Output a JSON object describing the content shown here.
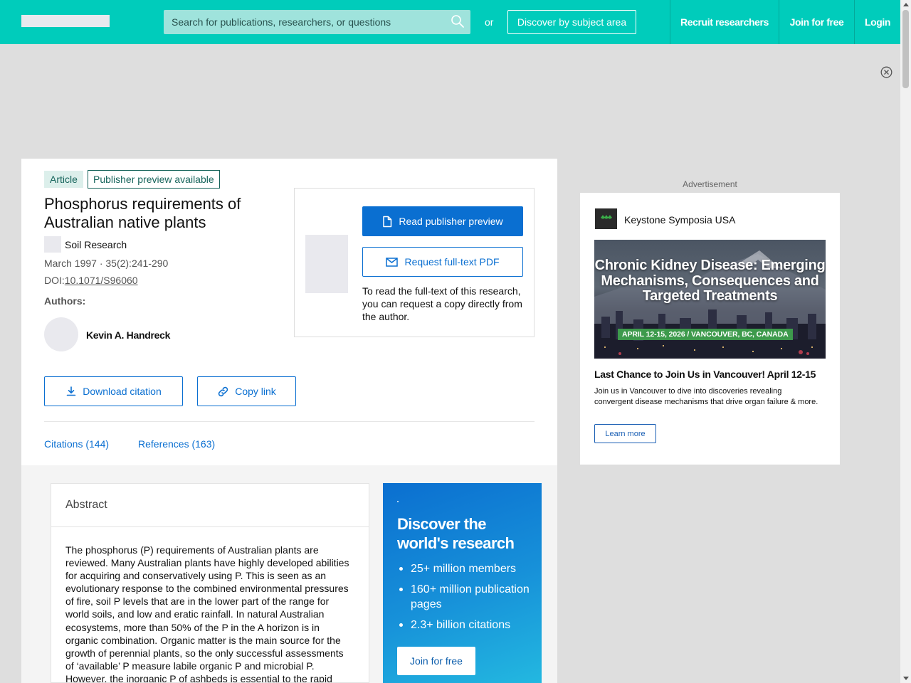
{
  "header": {
    "search_placeholder": "Search for publications, researchers, or questions",
    "or_text": "or",
    "discover_subject": "Discover by subject area",
    "nav": {
      "recruit": "Recruit researchers",
      "join": "Join for free",
      "login": "Login"
    },
    "colors": {
      "background": "#00ccbb",
      "text": "#ffffff"
    }
  },
  "article": {
    "badge_type": "Article",
    "badge_preview": "Publisher preview available",
    "title": "Phosphorus requirements of Australian native plants",
    "journal": "Soil Research",
    "date_volume": "March 1997 · 35(2):241-290",
    "doi_label": "DOI:",
    "doi": "10.1071/S96060",
    "authors_label": "Authors:",
    "authors": [
      {
        "name": "Kevin A. Handreck"
      }
    ],
    "actions": {
      "download_citation": "Download citation",
      "copy_link": "Copy link"
    },
    "tabs": {
      "citations": "Citations (144)",
      "references": "References (163)"
    }
  },
  "preview": {
    "read_button": "Read publisher preview",
    "request_button": "Request full-text PDF",
    "note": "To read the full-text of this research, you can request a copy directly from the author."
  },
  "abstract": {
    "heading": "Abstract",
    "text": "The phosphorus (P) requirements of Australian plants are reviewed. Many Australian plants have highly developed abilities for acquiring and conservatively using P. This is seen as an evolutionary response to the combined environmental pressures of fire, soil P levels that are in the lower part of the range for world soils, and low and eratic rainfall. In natural Australian ecosystems, more than 50% of the P in the A horizon is in organic combination. Organic matter is the main source for the growth of perennial plants, so the only successful assessments of ‘available’ P measure labile organic P and microbial P. However, the inorganic P of ashbeds is essential to the rapid establishment"
  },
  "discover": {
    "title": "Discover the world's research",
    "items": [
      "25+ million members",
      "160+ million publication pages",
      "2.3+ billion citations"
    ],
    "button": "Join for free"
  },
  "ad": {
    "label": "Advertisement",
    "brand": "Keystone Symposia USA",
    "image_title": "Chronic Kidney Disease: Emerging Mechanisms, Consequences and Targeted Treatments",
    "image_date": "APRIL 12-15, 2026 / VANCOUVER, BC, CANADA",
    "headline": "Last Chance to Join Us in Vancouver! April 12-15",
    "text": "Join us in Vancouver to dive into discoveries revealing convergent disease mechanisms that drive organ failure & more.",
    "button": "Learn more"
  },
  "colors": {
    "primary_blue": "#0a6fd1",
    "teal_badge": "#16645b",
    "ad_green": "#3d9a4c"
  },
  "icons": {
    "search": "search-icon",
    "close": "close-circle-icon",
    "document": "document-icon",
    "mail": "mail-icon",
    "download": "download-icon",
    "link": "link-icon"
  }
}
